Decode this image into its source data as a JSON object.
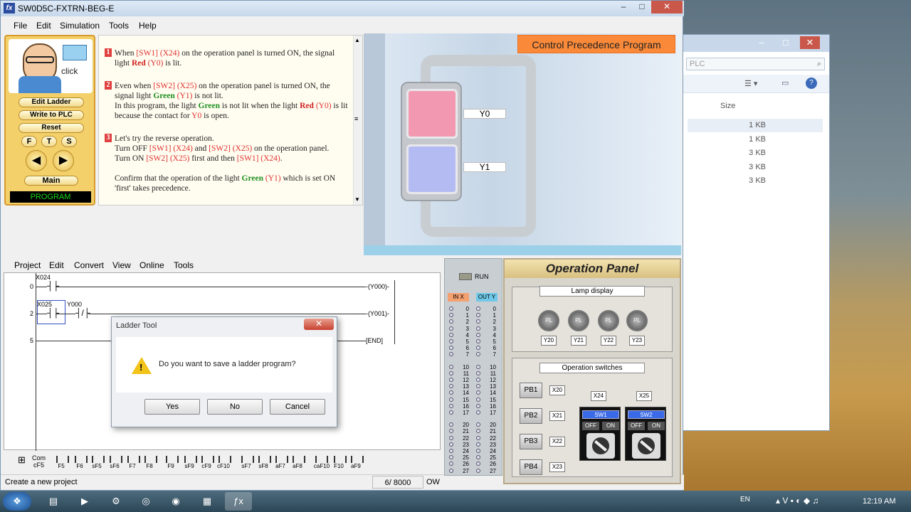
{
  "window": {
    "title": "SW0D5C-FXTRN-BEG-E",
    "logo": "fx"
  },
  "menu": [
    "File",
    "Edit",
    "Simulation",
    "Tools",
    "Help"
  ],
  "mascot": {
    "click": "click",
    "buttons": [
      "Edit Ladder",
      "Write to PLC",
      "Reset"
    ],
    "fts": [
      "F",
      "T",
      "S"
    ],
    "main": "Main",
    "mode": "PROGRAM"
  },
  "instructions": {
    "s1": {
      "n": "1",
      "a": "When ",
      "b": "[SW1] (X24)",
      "c": " on the operation panel is turned ON, the signal light ",
      "d": "Red",
      "e": " (Y0)",
      "f": " is lit."
    },
    "s2": {
      "n": "2",
      "a": "Even when ",
      "b": "[SW2] (X25)",
      "c": " on the operation panel is turned ON, the signal light ",
      "d": "Green",
      "e": " (Y1)",
      "f": " is not lit.",
      "g": "In this program, the light ",
      "h": "Green",
      "i": " is not lit when the light ",
      "j": "Red",
      "k": " (Y0)",
      "l": " is lit because the contact for ",
      "m": "Y0",
      "o": " is open."
    },
    "s3": {
      "n": "3",
      "a": "Let's try the reverse operation.",
      "b": "Turn OFF ",
      "c": "[SW1] (X24)",
      "d": " and ",
      "e": "[SW2] (X25)",
      "f": " on the operation panel.",
      "g": "Turn ON ",
      "h": "[SW2] (X25)",
      "i": " first and then ",
      "j": "[SW1] (X24)",
      "k": "."
    },
    "s4": {
      "a": "Confirm that the operation of the light ",
      "b": "Green",
      "c": " (Y1)",
      "d": " which is set ON 'first' takes precedence."
    }
  },
  "scene": {
    "title": "Control Precedence Program",
    "y0": "Y0",
    "y1": "Y1"
  },
  "ladder_menu": [
    "Project",
    "Edit",
    "Convert",
    "View",
    "Online",
    "Tools"
  ],
  "ladder": {
    "r0": "0",
    "r2": "2",
    "r5": "5",
    "x024": "X024",
    "x025": "X025",
    "y000c": "Y000",
    "out0": "Y000",
    "out1": "Y001",
    "end": "END"
  },
  "toolbar": [
    "F5",
    "F6",
    "sF5",
    "sF6",
    "F7",
    "F8",
    "F9",
    "sF9",
    "cF9",
    "cF10",
    "sF7",
    "sF8",
    "aF7",
    "aF8",
    "caF10",
    "F10",
    "aF9"
  ],
  "toolbar_first": "cF5",
  "toolbar_first_top": "Com",
  "status": {
    "left": "Create a new project",
    "count": "6/ 8000",
    "mode": "OW"
  },
  "io": {
    "run": "RUN",
    "in": "IN X",
    "out": "OUT Y",
    "nums": [
      "0",
      "1",
      "2",
      "3",
      "4",
      "5",
      "6",
      "7",
      "10",
      "11",
      "12",
      "13",
      "14",
      "15",
      "16",
      "17",
      "20",
      "21",
      "22",
      "23",
      "24",
      "25",
      "26",
      "27"
    ]
  },
  "opanel": {
    "title": "Operation Panel",
    "lamp_group": "Lamp display",
    "lamp": "PL",
    "ytags": [
      "Y20",
      "Y21",
      "Y22",
      "Y23"
    ],
    "sw_group": "Operation switches",
    "pbs": [
      "PB1",
      "PB2",
      "PB3",
      "PB4"
    ],
    "xtags": [
      "X20",
      "X21",
      "X22",
      "X23"
    ],
    "x24": "X24",
    "x25": "X25",
    "sw1": "SW1",
    "sw2": "SW2",
    "off": "OFF",
    "on": "ON"
  },
  "dialog": {
    "title": "Ladder Tool",
    "message": "Do you want to save a ladder program?",
    "yes": "Yes",
    "no": "No",
    "cancel": "Cancel",
    "warn": "!"
  },
  "explorer": {
    "search": "PLC",
    "size_header": "Size",
    "sizes": [
      "1 KB",
      "1 KB",
      "3 KB",
      "3 KB",
      "3 KB"
    ]
  },
  "tray": {
    "lang": "EN",
    "time": "12:19 AM"
  }
}
